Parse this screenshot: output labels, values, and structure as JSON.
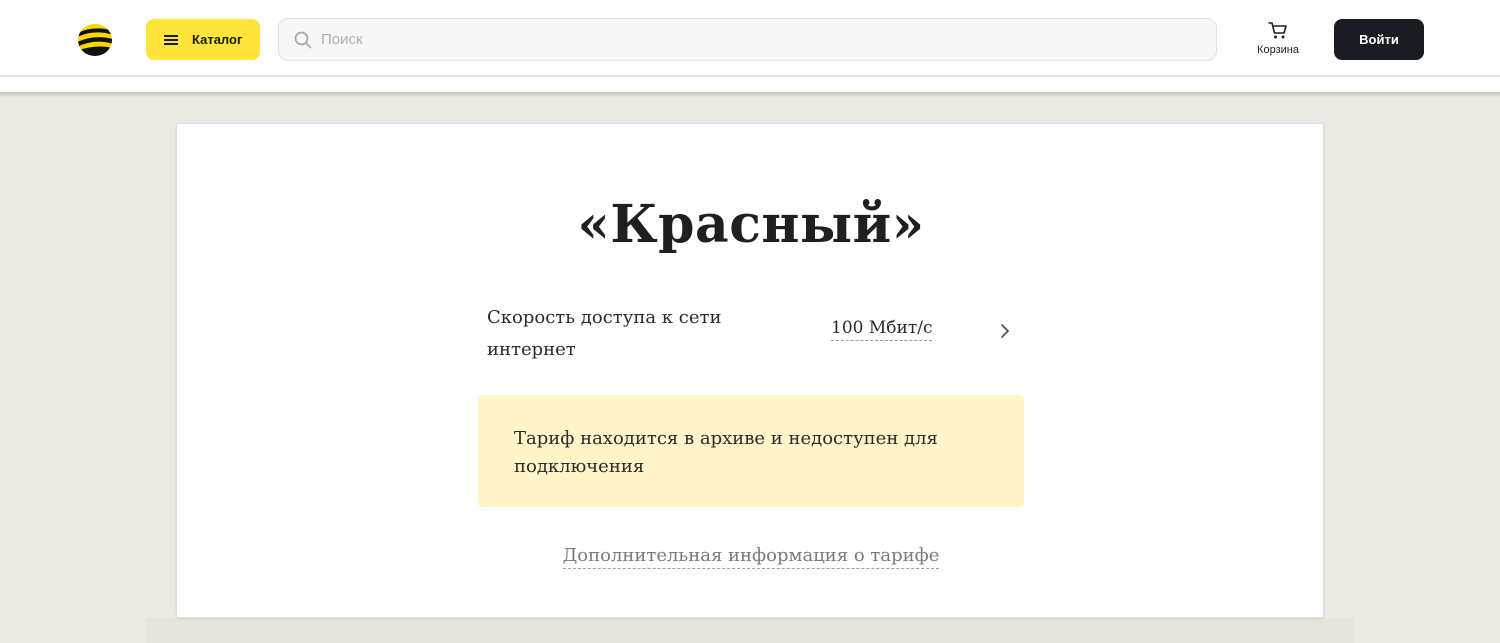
{
  "header": {
    "logo_icon": "beeline-logo-icon",
    "catalog_label": "Каталог",
    "search_placeholder": "Поиск",
    "cart_label": "Корзина",
    "login_label": "Войти"
  },
  "tariff": {
    "title": "«Красный»",
    "speed_label": "Скорость доступа к сети интернет",
    "speed_value": "100 Мбит/с",
    "archive_notice": "Тариф находится в архиве и недоступен для подключения",
    "more_info_link": "Дополнительная информация о тарифе"
  },
  "colors": {
    "accent_yellow": "#fee43b",
    "dark_button": "#191c20",
    "notice_background": "#fff5c8",
    "page_background": "#ece9e4"
  }
}
